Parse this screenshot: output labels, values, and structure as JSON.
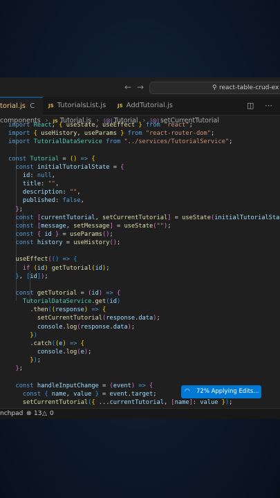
{
  "titlebar": {
    "back_icon": "arrow-left-icon",
    "forward_icon": "arrow-right-icon",
    "search_label": "react-table-crud-ex"
  },
  "tabs": [
    {
      "label": "torial.js",
      "badge": "",
      "modified_marker": "C",
      "active": true
    },
    {
      "label": "TutorialsList.js",
      "badge": "JS",
      "active": false
    },
    {
      "label": "AddTutorial.js",
      "badge": "JS",
      "active": false
    }
  ],
  "breadcrumb": [
    "components",
    "Tutorial.js",
    "Tutorial",
    "setCurrentTutorial"
  ],
  "breadcrumb_badges": {
    "file": "JS",
    "component": "[@]",
    "function": "[@]"
  },
  "code_lines": [
    "import React, { useState, useEffect } from \"react\";",
    "import { useHistory, useParams } from \"react-router-dom\";",
    "import TutorialDataService from \"../services/TutorialService\";",
    "",
    "const Tutorial = () => {",
    "  const initialTutorialState = {",
    "    id: null,",
    "    title: \"\",",
    "    description: \"\",",
    "    published: false,",
    "  };",
    "  const [currentTutorial, setCurrentTutorial] = useState(initialTutorialState);",
    "  const [message, setMessage] = useState(\"\");",
    "  const { id } = useParams();",
    "  const history = useHistory();",
    "",
    "  useEffect(() => {",
    "    if (id) getTutorial(id);",
    "  }, [id]);",
    "",
    "  const getTutorial = (id) => {",
    "    TutorialDataService.get(id)",
    "      .then((response) => {",
    "        setCurrentTutorial(response.data);",
    "        console.log(response.data);",
    "      })",
    "      .catch((e) => {",
    "        console.log(e);",
    "      });",
    "  };",
    "",
    "  const handleInputChange = (event) => {",
    "    const { name, value } = event.target;",
    "    setCurrentTutorial({ ...currentTutorial, [name]: value });"
  ],
  "toast": {
    "text": "72% Applying Edits...",
    "icon": "spinner-icon"
  },
  "status": {
    "left_label": "nchpad",
    "errors": "13",
    "warnings": "0",
    "error_icon": "error-circle-icon",
    "warning_icon": "warning-triangle-icon"
  },
  "colors": {
    "accent": "#0078d4",
    "editor_bg": "#1f1f1f",
    "keyword": "#569cd6",
    "string": "#ce9178",
    "function": "#dcdcaa",
    "variable": "#9cdcfe"
  }
}
